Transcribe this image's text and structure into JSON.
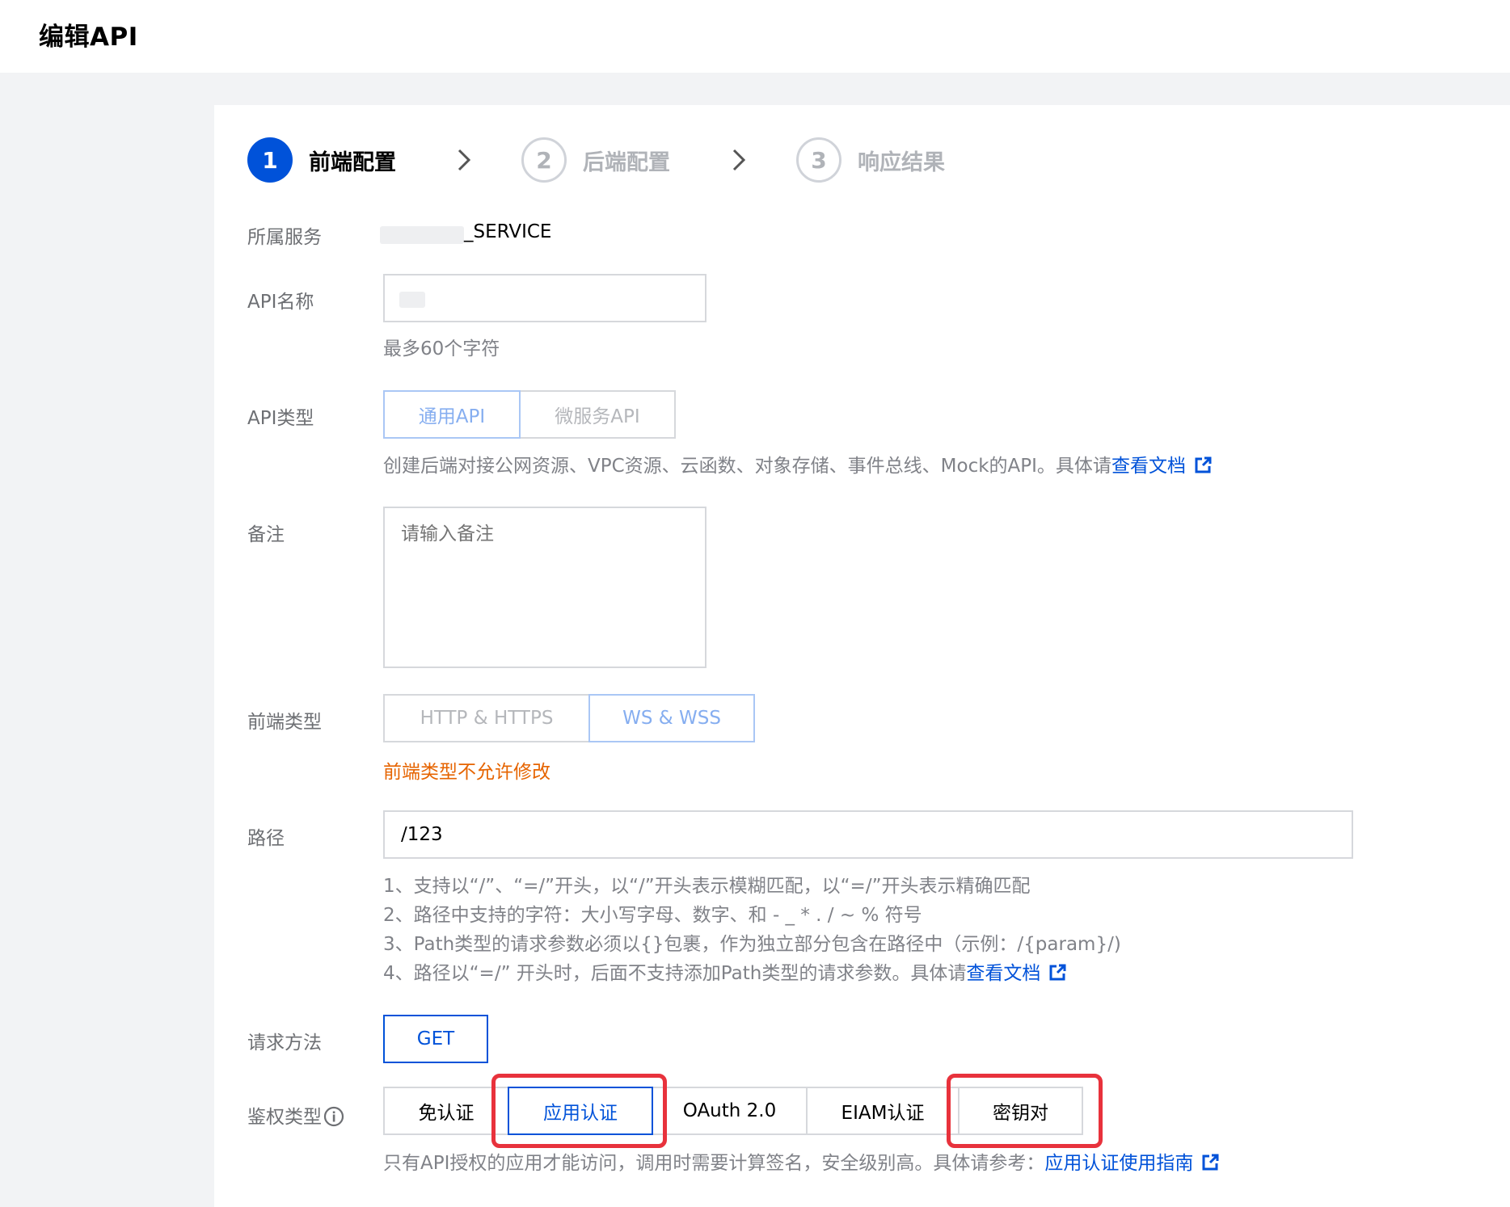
{
  "header": {
    "title": "编辑API"
  },
  "steps": [
    {
      "number": "1",
      "label": "前端配置"
    },
    {
      "number": "2",
      "label": "后端配置"
    },
    {
      "number": "3",
      "label": "响应结果"
    }
  ],
  "service": {
    "label": "所属服务",
    "value": "_SERVICE"
  },
  "api_name": {
    "label": "API名称",
    "value": "",
    "hint": "最多60个字符"
  },
  "api_type": {
    "label": "API类型",
    "options": [
      "通用API",
      "微服务API"
    ],
    "selected": "通用API",
    "hint": "创建后端对接公网资源、VPC资源、云函数、对象存储、事件总线、Mock的API。具体请",
    "link": "查看文档"
  },
  "remark": {
    "label": "备注",
    "placeholder": "请输入备注"
  },
  "frontend_type": {
    "label": "前端类型",
    "options": [
      "HTTP & HTTPS",
      "WS & WSS"
    ],
    "selected": "WS & WSS",
    "warning": "前端类型不允许修改"
  },
  "path": {
    "label": "路径",
    "value": "/123",
    "hints": [
      "1、支持以“/”、“=/”开头，以“/”开头表示模糊匹配，以“=/”开头表示精确匹配",
      "2、路径中支持的字符：大小写字母、数字、和 - _ * . / ~ % 符号",
      "3、Path类型的请求参数必须以{}包裹，作为独立部分包含在路径中（示例：/{param}/)",
      "4、路径以“=/” 开头时，后面不支持添加Path类型的请求参数。具体请"
    ],
    "link": "查看文档"
  },
  "method": {
    "label": "请求方法",
    "value": "GET"
  },
  "auth": {
    "label": "鉴权类型",
    "options": [
      "免认证",
      "应用认证",
      "OAuth 2.0",
      "EIAM认证",
      "密钥对"
    ],
    "selected": "应用认证",
    "hint": "只有API授权的应用才能访问，调用时需要计算签名，安全级别高。具体请参考：",
    "link": "应用认证使用指南"
  },
  "colors": {
    "primary": "#0052d9",
    "warning": "#e66400",
    "highlight": "#e8323c",
    "muted": "#808288"
  }
}
